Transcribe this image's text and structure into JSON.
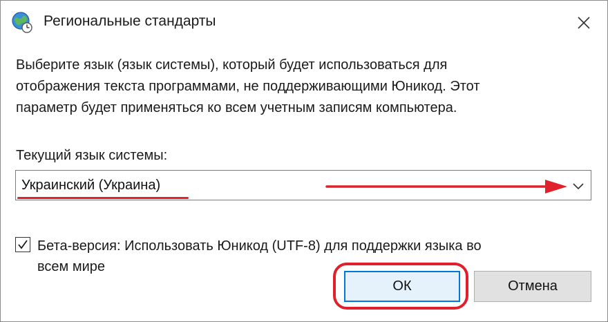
{
  "window": {
    "title": "Региональные стандарты",
    "title_icon": "globe-clock-icon",
    "close_icon": "close-icon"
  },
  "description": {
    "lines": [
      "Выберите язык (язык системы), который будет использоваться для",
      "отображения текста программами, не поддерживающими Юникод. Этот",
      "параметр будет применяться ко всем учетным записям компьютера."
    ]
  },
  "system_locale": {
    "label": "Текущий язык системы:",
    "selected": "Украинский (Украина)",
    "chevron_icon": "chevron-down-icon"
  },
  "beta_option": {
    "checked": true,
    "lines": [
      "Бета-версия: Использовать Юникод (UTF-8) для поддержки языка во",
      "всем мире"
    ]
  },
  "buttons": {
    "ok": "ОК",
    "cancel": "Отмена"
  },
  "annotations": {
    "color": "#e0202a"
  },
  "colors": {
    "accent": "#0078d7",
    "button_bg": "#e1e1e1"
  }
}
